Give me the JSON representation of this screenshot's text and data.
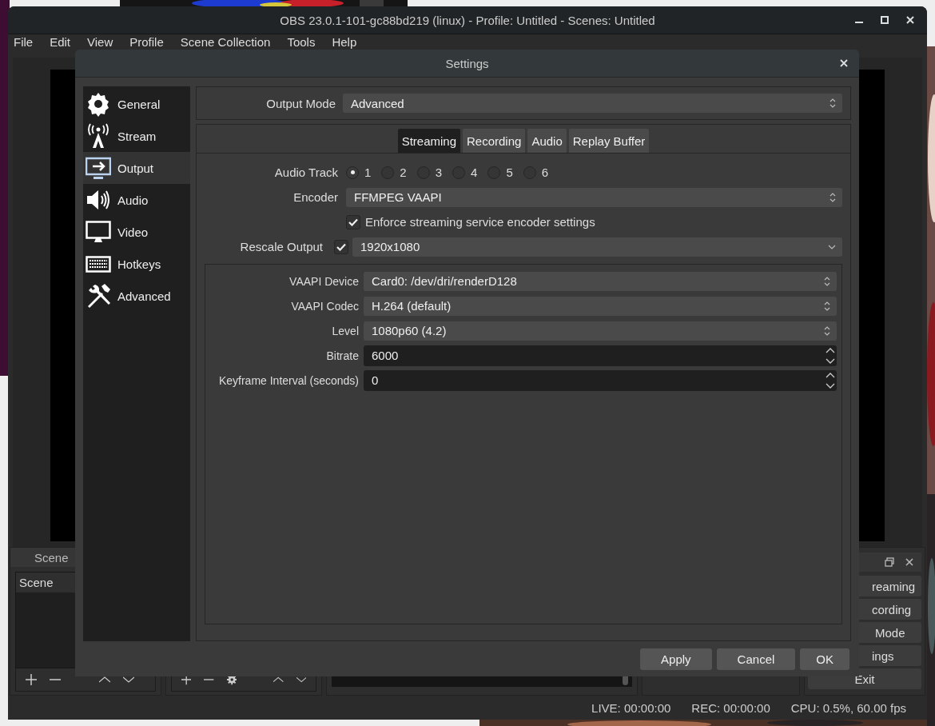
{
  "main_window": {
    "title": "OBS 23.0.1-101-gc88bd219 (linux) - Profile: Untitled - Scenes: Untitled",
    "menu": [
      "File",
      "Edit",
      "View",
      "Profile",
      "Scene Collection",
      "Tools",
      "Help"
    ],
    "scenes_dock": {
      "title": "Scene",
      "list_header": "Scene"
    },
    "controls_dock": {
      "buttons": [
        "reaming",
        "cording",
        "Mode",
        "ings",
        "Exit"
      ]
    },
    "status_bar": [
      "LIVE: 00:00:00",
      "REC: 00:00:00",
      "CPU: 0.5%, 60.00 fps"
    ]
  },
  "settings": {
    "title": "Settings",
    "sidebar": [
      {
        "label": "General",
        "selected": false
      },
      {
        "label": "Stream",
        "selected": false
      },
      {
        "label": "Output",
        "selected": true
      },
      {
        "label": "Audio",
        "selected": false
      },
      {
        "label": "Video",
        "selected": false
      },
      {
        "label": "Hotkeys",
        "selected": false
      },
      {
        "label": "Advanced",
        "selected": false
      }
    ],
    "output_mode": {
      "label": "Output Mode",
      "value": "Advanced"
    },
    "tabs": [
      {
        "label": "Streaming",
        "selected": true
      },
      {
        "label": "Recording",
        "selected": false
      },
      {
        "label": "Audio",
        "selected": false
      },
      {
        "label": "Replay Buffer",
        "selected": false
      }
    ],
    "audio_track": {
      "label": "Audio Track",
      "options": [
        {
          "label": "1",
          "selected": true
        },
        {
          "label": "2",
          "selected": false
        },
        {
          "label": "3",
          "selected": false
        },
        {
          "label": "4",
          "selected": false
        },
        {
          "label": "5",
          "selected": false
        },
        {
          "label": "6",
          "selected": false
        }
      ]
    },
    "encoder": {
      "label": "Encoder",
      "value": "FFMPEG VAAPI"
    },
    "enforce": {
      "label": "Enforce streaming service encoder settings",
      "checked": true
    },
    "rescale": {
      "label": "Rescale Output",
      "checked": true,
      "value": "1920x1080"
    },
    "encoder_settings": [
      {
        "label": "VAAPI Device",
        "kind": "combo",
        "value": "Card0: /dev/dri/renderD128"
      },
      {
        "label": "VAAPI Codec",
        "kind": "combo",
        "value": "H.264 (default)"
      },
      {
        "label": "Level",
        "kind": "combo",
        "value": "1080p60 (4.2)"
      },
      {
        "label": "Bitrate",
        "kind": "spin",
        "value": "6000"
      },
      {
        "label": "Keyframe Interval (seconds)",
        "kind": "spin",
        "value": "0"
      }
    ],
    "buttons": [
      "Apply",
      "Cancel",
      "OK"
    ]
  }
}
